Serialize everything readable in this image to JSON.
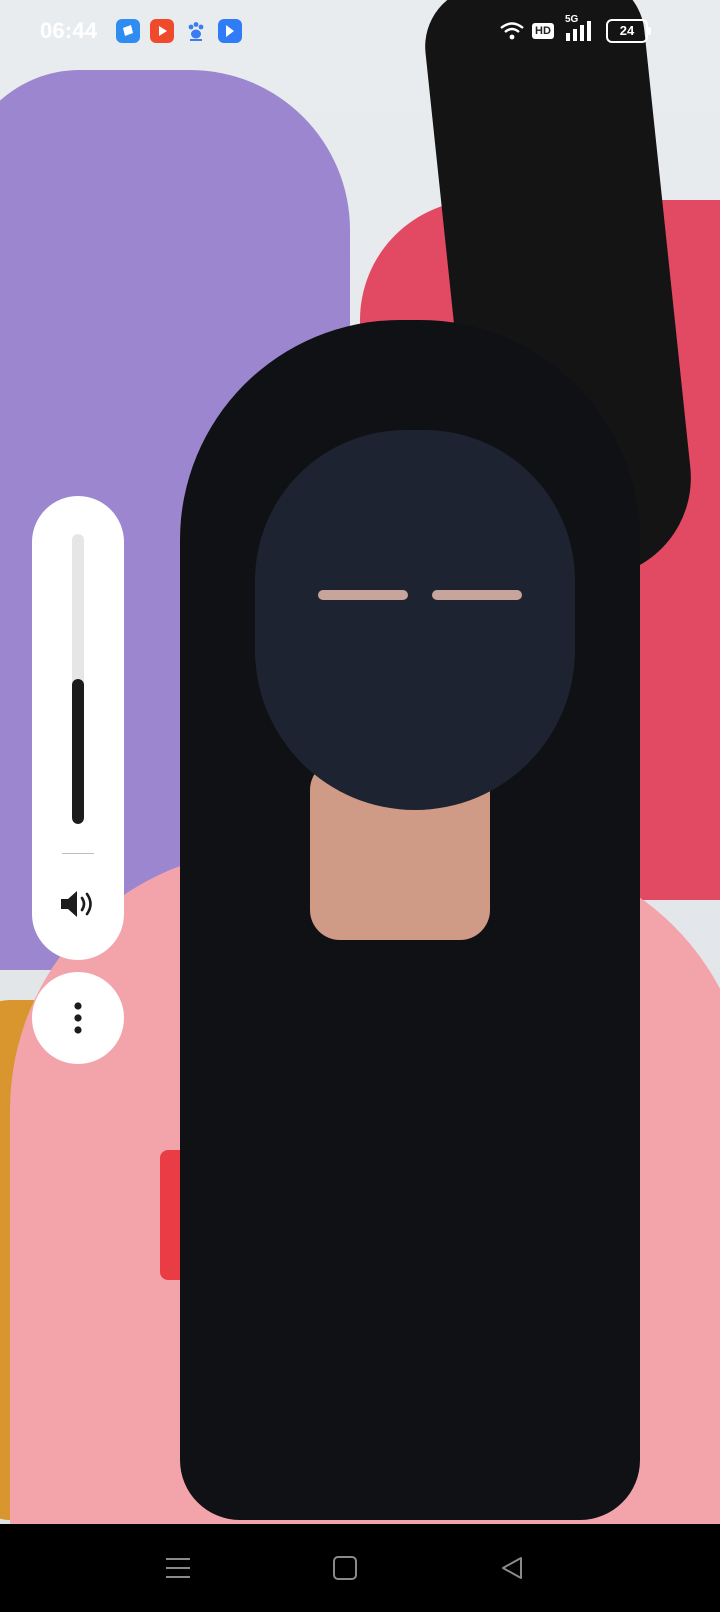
{
  "status_bar": {
    "time": "06:44",
    "network_type": "5G",
    "hd_label": "HD",
    "battery_level": "24",
    "notification_icons": [
      "shield-app-icon",
      "video-app-icon",
      "paw-app-icon",
      "arrow-app-icon"
    ]
  },
  "volume_panel": {
    "level_fraction": 0.5,
    "icon": "speaker-icon"
  },
  "more_button": {
    "icon": "more-vertical-icon"
  },
  "nav_bar": {
    "buttons": [
      "menu-icon",
      "home-icon",
      "back-icon"
    ]
  },
  "colors": {
    "panel_bg": "#ffffff",
    "slider_fill": "#1c1c1c",
    "slider_track": "#e6e6e6"
  }
}
